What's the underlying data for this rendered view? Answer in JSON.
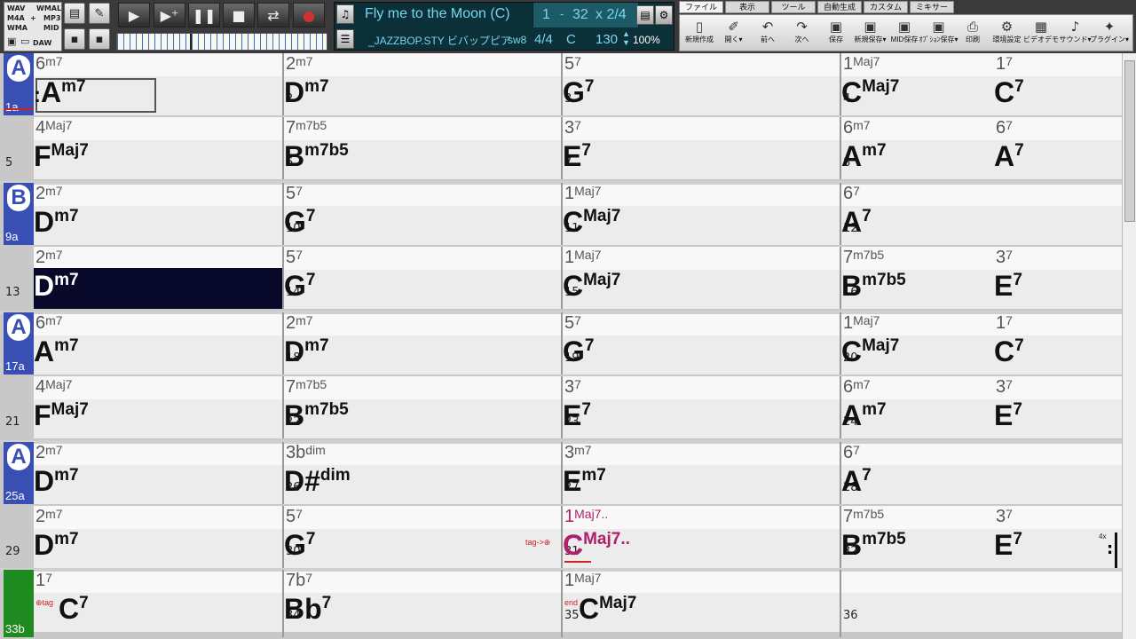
{
  "format_labels": [
    "WAV",
    "WMAL",
    "M4A",
    "+",
    "MP3",
    "WMA",
    "MID",
    "DAW"
  ],
  "song": {
    "title": "Fly me to the Moon (C)",
    "bar_start": "1",
    "bar_dash": "-",
    "bar_end": "32",
    "repeat": "x 2/4",
    "style": "_JAZZBOP.STY ビバップピア",
    "style_code": "sw8",
    "time_signature": "4/4",
    "key": "C",
    "tempo": "130",
    "zoom": "100%"
  },
  "menu": [
    "ファイル",
    "表示",
    "ツール",
    "自動生成",
    "カスタム",
    "ミキサー"
  ],
  "ribbon": [
    {
      "label": "新規作成",
      "icon": "new-file-icon"
    },
    {
      "label": "開く▾",
      "icon": "open-icon"
    },
    {
      "label": "前へ",
      "icon": "previous-icon"
    },
    {
      "label": "次へ",
      "icon": "next-icon"
    },
    {
      "label": "保存",
      "icon": "save-icon"
    },
    {
      "label": "新規保存▾",
      "icon": "save-as-icon"
    },
    {
      "label": "MID保存",
      "icon": "midi-save-icon"
    },
    {
      "label": "ｵﾌﾟｼｮﾝ保存▾",
      "icon": "save-options-icon"
    },
    {
      "label": "印刷",
      "icon": "print-icon"
    },
    {
      "label": "環境設定",
      "icon": "preferences-icon"
    },
    {
      "label": "ビデオデモ",
      "icon": "video-demo-icon"
    },
    {
      "label": "サウンド▾",
      "icon": "sound-icon"
    },
    {
      "label": "プラグイン▾",
      "icon": "plugin-icon"
    }
  ],
  "parts": [
    {
      "row": 0,
      "letter": "A",
      "num": "1a",
      "color": "#3a4fb4"
    },
    {
      "row": 2,
      "letter": "B",
      "num": "9a",
      "color": "#3a4fb4"
    },
    {
      "row": 4,
      "letter": "A",
      "num": "17a",
      "color": "#3a4fb4"
    },
    {
      "row": 6,
      "letter": "A",
      "num": "25a",
      "color": "#3a4fb4"
    },
    {
      "row": 8,
      "letter": "",
      "num": "33b",
      "color": "#1f8a1f"
    }
  ],
  "bars": [
    {
      "num": "1",
      "chords": [
        {
          "root": "A",
          "ext": "m7",
          "roman": "6",
          "rext": "m7",
          "pre": ":"
        }
      ]
    },
    {
      "num": "2",
      "chords": [
        {
          "root": "D",
          "ext": "m7",
          "roman": "2",
          "rext": "m7"
        }
      ]
    },
    {
      "num": "3",
      "chords": [
        {
          "root": "G",
          "ext": "7",
          "roman": "5",
          "rext": "7"
        }
      ]
    },
    {
      "num": "4",
      "chords": [
        {
          "root": "C",
          "ext": "Maj7",
          "roman": "1",
          "rext": "Maj7"
        },
        {
          "root": "C",
          "ext": "7",
          "roman": "1",
          "rext": "7"
        }
      ]
    },
    {
      "num": "5",
      "chords": [
        {
          "root": "F",
          "ext": "Maj7",
          "roman": "4",
          "rext": "Maj7"
        }
      ]
    },
    {
      "num": "6",
      "chords": [
        {
          "root": "B",
          "ext": "m7b5",
          "roman": "7",
          "rext": "m7b5"
        }
      ]
    },
    {
      "num": "7",
      "chords": [
        {
          "root": "E",
          "ext": "7",
          "roman": "3",
          "rext": "7"
        }
      ]
    },
    {
      "num": "8",
      "chords": [
        {
          "root": "A",
          "ext": "m7",
          "roman": "6",
          "rext": "m7"
        },
        {
          "root": "A",
          "ext": "7",
          "roman": "6",
          "rext": "7"
        }
      ]
    },
    {
      "num": "9",
      "chords": [
        {
          "root": "D",
          "ext": "m7",
          "roman": "2",
          "rext": "m7"
        }
      ]
    },
    {
      "num": "10",
      "chords": [
        {
          "root": "G",
          "ext": "7",
          "roman": "5",
          "rext": "7"
        }
      ]
    },
    {
      "num": "11",
      "chords": [
        {
          "root": "C",
          "ext": "Maj7",
          "roman": "1",
          "rext": "Maj7"
        }
      ]
    },
    {
      "num": "12",
      "chords": [
        {
          "root": "A",
          "ext": "7",
          "roman": "6",
          "rext": "7"
        }
      ]
    },
    {
      "num": "13",
      "chords": [
        {
          "root": "D",
          "ext": "m7",
          "roman": "2",
          "rext": "m7"
        }
      ]
    },
    {
      "num": "14",
      "chords": [
        {
          "root": "G",
          "ext": "7",
          "roman": "5",
          "rext": "7"
        }
      ]
    },
    {
      "num": "15",
      "chords": [
        {
          "root": "C",
          "ext": "Maj7",
          "roman": "1",
          "rext": "Maj7"
        }
      ]
    },
    {
      "num": "16",
      "chords": [
        {
          "root": "B",
          "ext": "m7b5",
          "roman": "7",
          "rext": "m7b5"
        },
        {
          "root": "E",
          "ext": "7",
          "roman": "3",
          "rext": "7"
        }
      ]
    },
    {
      "num": "17",
      "chords": [
        {
          "root": "A",
          "ext": "m7",
          "roman": "6",
          "rext": "m7"
        }
      ]
    },
    {
      "num": "18",
      "chords": [
        {
          "root": "D",
          "ext": "m7",
          "roman": "2",
          "rext": "m7"
        }
      ]
    },
    {
      "num": "19",
      "chords": [
        {
          "root": "G",
          "ext": "7",
          "roman": "5",
          "rext": "7"
        }
      ]
    },
    {
      "num": "20",
      "chords": [
        {
          "root": "C",
          "ext": "Maj7",
          "roman": "1",
          "rext": "Maj7"
        },
        {
          "root": "C",
          "ext": "7",
          "roman": "1",
          "rext": "7"
        }
      ]
    },
    {
      "num": "21",
      "chords": [
        {
          "root": "F",
          "ext": "Maj7",
          "roman": "4",
          "rext": "Maj7"
        }
      ]
    },
    {
      "num": "22",
      "chords": [
        {
          "root": "B",
          "ext": "m7b5",
          "roman": "7",
          "rext": "m7b5"
        }
      ]
    },
    {
      "num": "23",
      "chords": [
        {
          "root": "E",
          "ext": "7",
          "roman": "3",
          "rext": "7"
        }
      ]
    },
    {
      "num": "24",
      "chords": [
        {
          "root": "A",
          "ext": "m7",
          "roman": "6",
          "rext": "m7"
        },
        {
          "root": "E",
          "ext": "7",
          "roman": "3",
          "rext": "7"
        }
      ]
    },
    {
      "num": "25",
      "chords": [
        {
          "root": "D",
          "ext": "m7",
          "roman": "2",
          "rext": "m7"
        }
      ]
    },
    {
      "num": "26",
      "chords": [
        {
          "root": "D#",
          "ext": "dim",
          "roman": "3b",
          "rext": "dim"
        }
      ]
    },
    {
      "num": "27",
      "chords": [
        {
          "root": "E",
          "ext": "m7",
          "roman": "3",
          "rext": "m7"
        }
      ]
    },
    {
      "num": "28",
      "chords": [
        {
          "root": "A",
          "ext": "7",
          "roman": "6",
          "rext": "7"
        }
      ]
    },
    {
      "num": "29",
      "chords": [
        {
          "root": "D",
          "ext": "m7",
          "roman": "2",
          "rext": "m7"
        }
      ]
    },
    {
      "num": "30",
      "chords": [
        {
          "root": "G",
          "ext": "7",
          "roman": "5",
          "rext": "7"
        }
      ]
    },
    {
      "num": "31",
      "chords": [
        {
          "root": "C",
          "ext": "Maj7..",
          "roman": "1",
          "rext": "Maj7..",
          "color": "#b0206a"
        }
      ],
      "marker": "tag->⊕"
    },
    {
      "num": "32",
      "chords": [
        {
          "root": "B",
          "ext": "m7b5",
          "roman": "7",
          "rext": "m7b5"
        },
        {
          "root": "E",
          "ext": "7",
          "roman": "3",
          "rext": "7"
        }
      ],
      "end_marker": "4x"
    },
    {
      "num": "",
      "chords": [
        {
          "root": "C",
          "ext": "7",
          "roman": "1",
          "rext": "7"
        }
      ],
      "marker": "⊕tag"
    },
    {
      "num": "34",
      "chords": [
        {
          "root": "Bb",
          "ext": "7",
          "roman": "7b",
          "rext": "7"
        }
      ]
    },
    {
      "num": "35",
      "chords": [
        {
          "root": "C",
          "ext": "Maj7",
          "roman": "1",
          "rext": "Maj7"
        }
      ],
      "marker": "end"
    },
    {
      "num": "36",
      "chords": []
    }
  ],
  "highlight_bar": "13",
  "cursor_bar": "1",
  "colors": {
    "part_blue": "#3a4fb4",
    "part_green": "#1f8a1f",
    "highlight": "#08082a",
    "tag_red": "#cc2222",
    "purple": "#b0206a"
  }
}
